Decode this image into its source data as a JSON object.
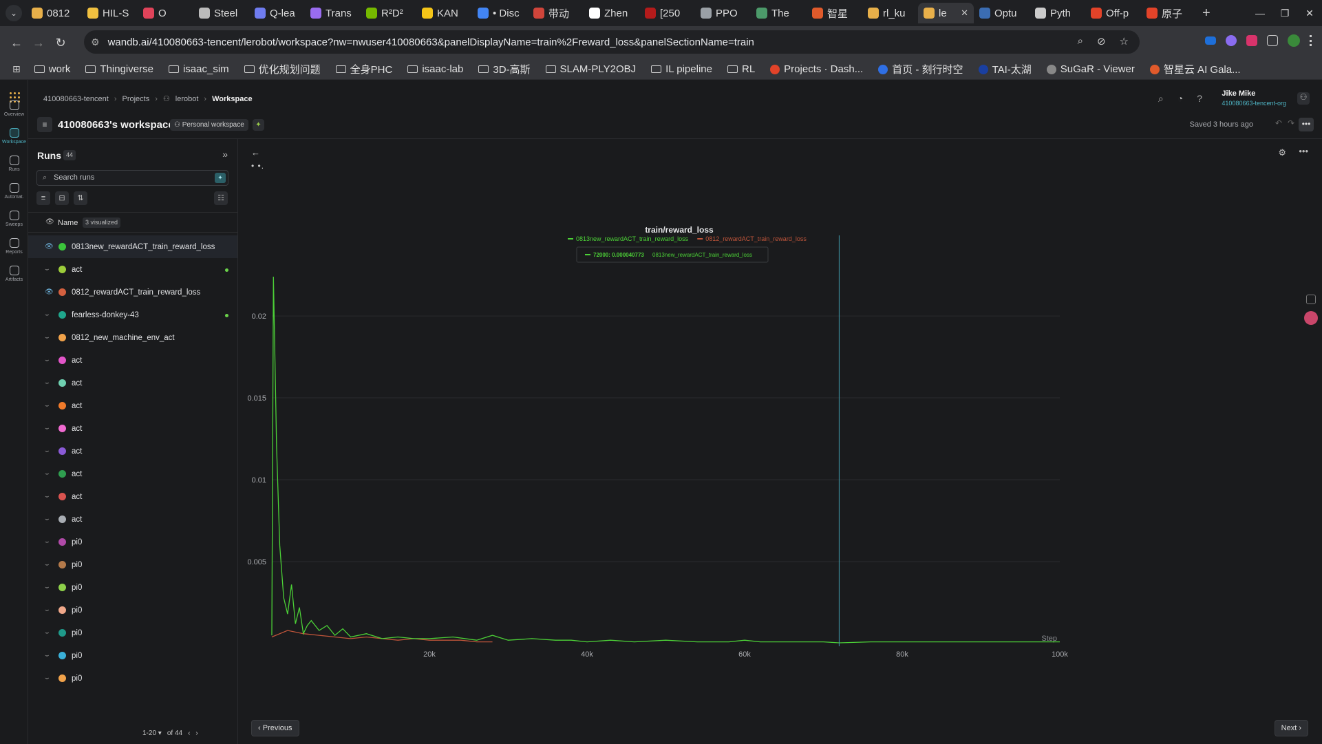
{
  "browser": {
    "tabs": [
      {
        "title": "0812",
        "color": "#e8b04a"
      },
      {
        "title": "HIL-S",
        "color": "#f0c040"
      },
      {
        "title": "O",
        "color": "#e0435a"
      },
      {
        "title": "Steel",
        "color": "#bbbbbb"
      },
      {
        "title": "Q-lea",
        "color": "#6f7cf0"
      },
      {
        "title": "Trans",
        "color": "#9a6cf0"
      },
      {
        "title": "R²D²",
        "color": "#76b900"
      },
      {
        "title": "KAN",
        "color": "#f5c518"
      },
      {
        "title": "• Disc",
        "color": "#4285f4"
      },
      {
        "title": "带动",
        "color": "#d0453b"
      },
      {
        "title": "Zhen",
        "color": "#ffffff"
      },
      {
        "title": "[250",
        "color": "#b31b1b"
      },
      {
        "title": "PPO",
        "color": "#9aa0a6"
      },
      {
        "title": "The",
        "color": "#4c9a6a"
      },
      {
        "title": "智星",
        "color": "#e05a2b"
      },
      {
        "title": "rl_ku",
        "color": "#e8b04a"
      },
      {
        "title": "le",
        "color": "#e8b04a",
        "active": true
      },
      {
        "title": "Optu",
        "color": "#3b6db3"
      },
      {
        "title": "Pyth",
        "color": "#cccccc"
      },
      {
        "title": "Off-p",
        "color": "#e24329"
      },
      {
        "title": "原子",
        "color": "#e24329"
      }
    ],
    "new_tab": "+",
    "url": "wandb.ai/410080663-tencent/lerobot/workspace?nw=nwuser410080663&panelDisplayName=train%2Freward_loss&panelSectionName=train",
    "bookmarks": [
      {
        "label": "work",
        "type": "folder"
      },
      {
        "label": "Thingiverse",
        "type": "folder"
      },
      {
        "label": "isaac_sim",
        "type": "folder"
      },
      {
        "label": "优化规划问题",
        "type": "folder"
      },
      {
        "label": "全身PHC",
        "type": "folder"
      },
      {
        "label": "isaac-lab",
        "type": "folder"
      },
      {
        "label": "3D-高斯",
        "type": "folder"
      },
      {
        "label": "SLAM-PLY2OBJ",
        "type": "folder"
      },
      {
        "label": "IL pipeline",
        "type": "folder"
      },
      {
        "label": "RL",
        "type": "folder"
      },
      {
        "label": "Projects · Dash...",
        "type": "site",
        "color": "#e24329"
      },
      {
        "label": "首页 - 刻行时空",
        "type": "site",
        "color": "#2f6fe4"
      },
      {
        "label": "TAI-太湖",
        "type": "site",
        "color": "#1a3fa0"
      },
      {
        "label": "SuGaR - Viewer",
        "type": "site",
        "color": "#888888"
      },
      {
        "label": "智星云 AI Gala...",
        "type": "site",
        "color": "#e05a2b"
      }
    ]
  },
  "app": {
    "breadcrumb": [
      "410080663-tencent",
      "Projects",
      "lerobot",
      "Workspace"
    ],
    "user": {
      "name": "Jike Mike",
      "org": "410080663-tencent-org"
    },
    "workspace_title": "410080663's workspace",
    "workspace_badge": "Personal workspace",
    "saved": "Saved 3 hours ago",
    "rail": [
      {
        "label": "Overview",
        "active": false
      },
      {
        "label": "Workspace",
        "active": true
      },
      {
        "label": "Runs",
        "active": false
      },
      {
        "label": "Automat.",
        "active": false
      },
      {
        "label": "Sweeps",
        "active": false
      },
      {
        "label": "Reports",
        "active": false
      },
      {
        "label": "Artifacts",
        "active": false
      }
    ]
  },
  "runs_panel": {
    "title": "Runs",
    "count": "44",
    "search_placeholder": "Search runs",
    "name_header": "Name",
    "visualized": "3 visualized",
    "runs": [
      {
        "name": "0813new_rewardACT_train_reward_loss",
        "color": "#3bc43b",
        "visible": true,
        "selected": true,
        "live": false
      },
      {
        "name": "act",
        "color": "#9ccc3a",
        "visible": false,
        "selected": false,
        "live": true
      },
      {
        "name": "0812_rewardACT_train_reward_loss",
        "color": "#d4603f",
        "visible": true,
        "selected": false,
        "live": false
      },
      {
        "name": "fearless-donkey-43",
        "color": "#1fa68c",
        "visible": false,
        "selected": false,
        "live": true
      },
      {
        "name": "0812_new_machine_env_act",
        "color": "#f0a24a",
        "visible": false,
        "selected": false,
        "live": false
      },
      {
        "name": "act",
        "color": "#e255c8",
        "visible": false,
        "selected": false,
        "live": false
      },
      {
        "name": "act",
        "color": "#6fd0b0",
        "visible": false,
        "selected": false,
        "live": false
      },
      {
        "name": "act",
        "color": "#f07a2a",
        "visible": false,
        "selected": false,
        "live": false
      },
      {
        "name": "act",
        "color": "#f06ad0",
        "visible": false,
        "selected": false,
        "live": false
      },
      {
        "name": "act",
        "color": "#8a5ad6",
        "visible": false,
        "selected": false,
        "live": false
      },
      {
        "name": "act",
        "color": "#2f9e4f",
        "visible": false,
        "selected": false,
        "live": false
      },
      {
        "name": "act",
        "color": "#d9534f",
        "visible": false,
        "selected": false,
        "live": false
      },
      {
        "name": "act",
        "color": "#a8adb3",
        "visible": false,
        "selected": false,
        "live": false
      },
      {
        "name": "pi0",
        "color": "#b04aa8",
        "visible": false,
        "selected": false,
        "live": false
      },
      {
        "name": "pi0",
        "color": "#b47a4a",
        "visible": false,
        "selected": false,
        "live": false
      },
      {
        "name": "pi0",
        "color": "#8ed04a",
        "visible": false,
        "selected": false,
        "live": false
      },
      {
        "name": "pi0",
        "color": "#f0a88a",
        "visible": false,
        "selected": false,
        "live": false
      },
      {
        "name": "pi0",
        "color": "#1f9a8a",
        "visible": false,
        "selected": false,
        "live": false
      },
      {
        "name": "pi0",
        "color": "#3ab0d8",
        "visible": false,
        "selected": false,
        "live": false
      },
      {
        "name": "pi0",
        "color": "#f0a24a",
        "visible": false,
        "selected": false,
        "live": false
      }
    ],
    "pager": {
      "range": "1-20",
      "of": "of 44"
    }
  },
  "chart_panel": {
    "prev_label": "Previous",
    "next_label": "Next",
    "tooltip": {
      "step": "72000",
      "value": "0.000040773",
      "series": "0813new_rewardACT_train_reward_loss"
    }
  },
  "chart_data": {
    "type": "line",
    "title": "train/reward_loss",
    "xlabel": "Step",
    "ylabel": "",
    "xlim": [
      0,
      100000
    ],
    "ylim": [
      0,
      0.0245
    ],
    "xticks": [
      {
        "v": 20000,
        "label": "20k"
      },
      {
        "v": 40000,
        "label": "40k"
      },
      {
        "v": 60000,
        "label": "60k"
      },
      {
        "v": 80000,
        "label": "80k"
      },
      {
        "v": 100000,
        "label": "100k"
      }
    ],
    "yticks": [
      {
        "v": 0.005,
        "label": "0.005"
      },
      {
        "v": 0.01,
        "label": "0.01"
      },
      {
        "v": 0.015,
        "label": "0.015"
      },
      {
        "v": 0.02,
        "label": "0.02"
      }
    ],
    "grid": true,
    "legend": "top-center",
    "cursor_x": 72000,
    "series": [
      {
        "name": "0813new_rewardACT_train_reward_loss",
        "color": "#4cd137",
        "x": [
          0,
          200,
          600,
          1000,
          1500,
          2000,
          2500,
          3000,
          3500,
          4000,
          4500,
          5000,
          6000,
          7000,
          8000,
          9000,
          10000,
          12000,
          14000,
          16000,
          18000,
          20000,
          23000,
          26000,
          28000,
          30000,
          33000,
          36000,
          38000,
          40000,
          43000,
          46000,
          50000,
          54000,
          58000,
          60000,
          62000,
          66000,
          70000,
          72000,
          76000,
          80000,
          85000,
          90000,
          95000,
          100000
        ],
        "y": [
          0.0005,
          0.0224,
          0.012,
          0.006,
          0.0028,
          0.0018,
          0.0036,
          0.0012,
          0.0022,
          0.0006,
          0.0011,
          0.0014,
          0.0008,
          0.0011,
          0.0005,
          0.0009,
          0.0004,
          0.0006,
          0.0003,
          0.0004,
          0.0003,
          0.0003,
          0.0004,
          0.0002,
          0.0005,
          0.0002,
          0.0003,
          0.0002,
          0.0002,
          0.0001,
          0.0002,
          0.0001,
          0.0002,
          0.0001,
          0.0001,
          0.0002,
          0.0001,
          0.0001,
          0.0001,
          4e-05,
          0.0001,
          0.0001,
          0.0001,
          0.0001,
          0.0001,
          0.0001
        ]
      },
      {
        "name": "0812_rewardACT_train_reward_loss",
        "color": "#c0553a",
        "x": [
          0,
          2000,
          4000,
          6000,
          8000,
          10000,
          12000,
          14000,
          16000,
          18000,
          20000,
          22000,
          24000,
          26000,
          28000
        ],
        "y": [
          0.0004,
          0.0008,
          0.0006,
          0.0005,
          0.0004,
          0.0003,
          0.0004,
          0.0003,
          0.0002,
          0.0003,
          0.0002,
          0.0002,
          0.0002,
          0.0001,
          0.0001
        ]
      }
    ]
  }
}
